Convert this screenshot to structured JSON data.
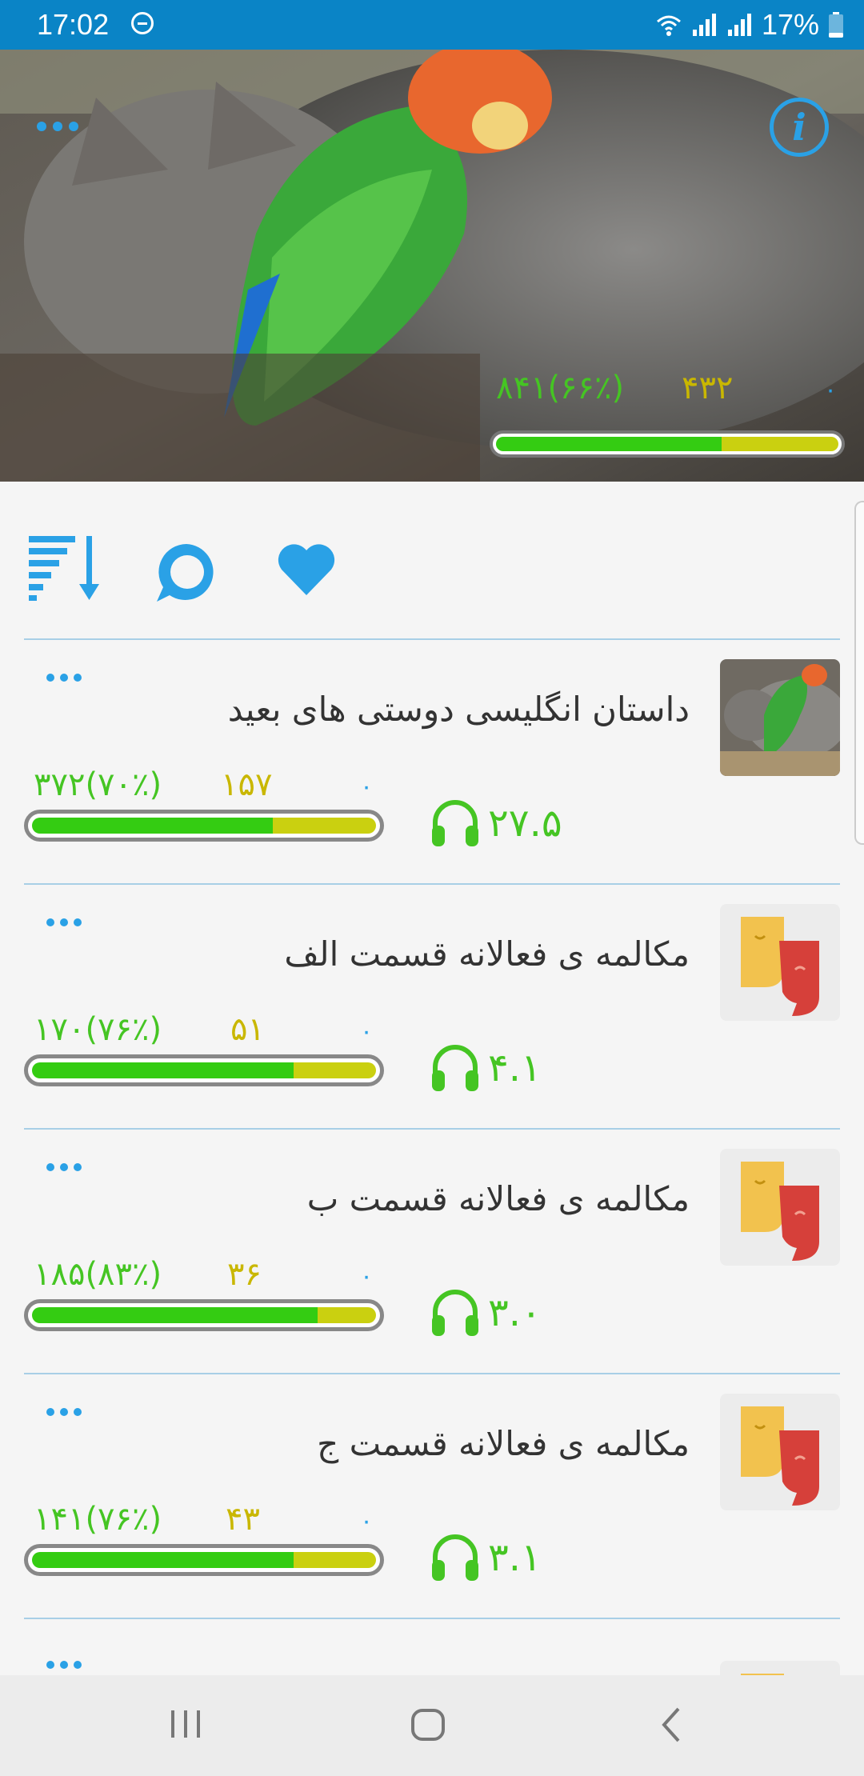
{
  "status": {
    "time": "17:02",
    "battery": "17%"
  },
  "hero": {
    "stat_total": "۸۴۱(۶۶٪)",
    "stat_mid": "۴۳۲",
    "stat_zero": "۰",
    "progress_green": 0.66,
    "menu_icon": "more-horizontal-icon",
    "info_icon": "info-icon"
  },
  "toolbar": {
    "sort_icon": "sort-icon",
    "chat_icon": "chat-bubble-icon",
    "favorite_icon": "heart-icon"
  },
  "items": [
    {
      "title": "داستان انگلیسی دوستی های بعید",
      "stat_total": "۳۷۲(۷۰٪)",
      "stat_mid": "۱۵۷",
      "stat_zero": "۰",
      "duration": "۲۷.۵",
      "progress_green": 0.7,
      "thumb": "photo"
    },
    {
      "title": "مکالمه ی فعالانه قسمت الف",
      "stat_total": "۱۷۰(۷۶٪)",
      "stat_mid": "۵۱",
      "stat_zero": "۰",
      "duration": "۴.۱",
      "progress_green": 0.76,
      "thumb": "quote-masks"
    },
    {
      "title": "مکالمه ی فعالانه قسمت ب",
      "stat_total": "۱۸۵(۸۳٪)",
      "stat_mid": "۳۶",
      "stat_zero": "۰",
      "duration": "۳.۰",
      "progress_green": 0.83,
      "thumb": "quote-masks"
    },
    {
      "title": "مکالمه ی فعالانه قسمت ج",
      "stat_total": "۱۴۱(۷۶٪)",
      "stat_mid": "۴۳",
      "stat_zero": "۰",
      "duration": "۳.۱",
      "progress_green": 0.76,
      "thumb": "quote-masks"
    }
  ],
  "colors": {
    "accent": "#2aa1e6",
    "status_bar": "#0a84c6",
    "progress_green": "#34cc12",
    "progress_yellow": "#cad010",
    "stat_green": "#45c523",
    "stat_yellow": "#c9b700"
  },
  "navbar": {
    "recents_icon": "recents-icon",
    "home_icon": "home-icon",
    "back_icon": "back-icon"
  }
}
